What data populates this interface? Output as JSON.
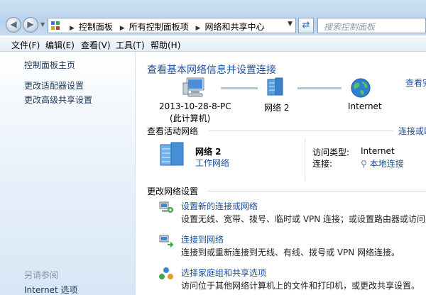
{
  "address_bar": {
    "crumbs": [
      "控制面板",
      "所有控制面板项",
      "网络和共享中心"
    ]
  },
  "search": {
    "placeholder": "搜索控制面板"
  },
  "menu": {
    "file": "文件(F)",
    "edit": "编辑(E)",
    "view": "查看(V)",
    "tools": "工具(T)",
    "help": "帮助(H)"
  },
  "sidebar": {
    "items": [
      {
        "label": "控制面板主页"
      },
      {
        "label": "更改适配器设置"
      },
      {
        "label": "更改高级共享设置"
      }
    ],
    "see_also_title": "另请参阅",
    "see_also_items": [
      {
        "label": "Internet 选项"
      }
    ]
  },
  "main": {
    "heading": "查看基本网络信息并设置连接",
    "see_full_map": "查看完",
    "map": {
      "computer_name": "2013-10-28-8-PC",
      "computer_sub": "(此计算机)",
      "network_label": "网络  2",
      "internet_label": "Internet"
    },
    "active_networks": {
      "title": "查看活动网络",
      "link": "连接或断",
      "network_name": "网络  2",
      "network_type": "工作网络",
      "access_type_label": "访问类型:",
      "access_type_value": "Internet",
      "connections_label": "连接:",
      "connections_value": "本地连接"
    },
    "change_settings": {
      "title": "更改网络设置",
      "tasks": [
        {
          "title": "设置新的连接或网络",
          "desc": "设置无线、宽带、拨号、临时或 VPN 连接；或设置路由器或访问点。"
        },
        {
          "title": "连接到网络",
          "desc": "连接到或重新连接到无线、有线、拨号或 VPN 网络连接。"
        },
        {
          "title": "选择家庭组和共享选项",
          "desc": "访问位于其他网络计算机上的文件和打印机，或更改共享设置。"
        }
      ]
    }
  },
  "colors": {
    "link": "#1e4fa0",
    "sidebar_link": "#1e395b",
    "chrome": "#b8d2ec"
  }
}
